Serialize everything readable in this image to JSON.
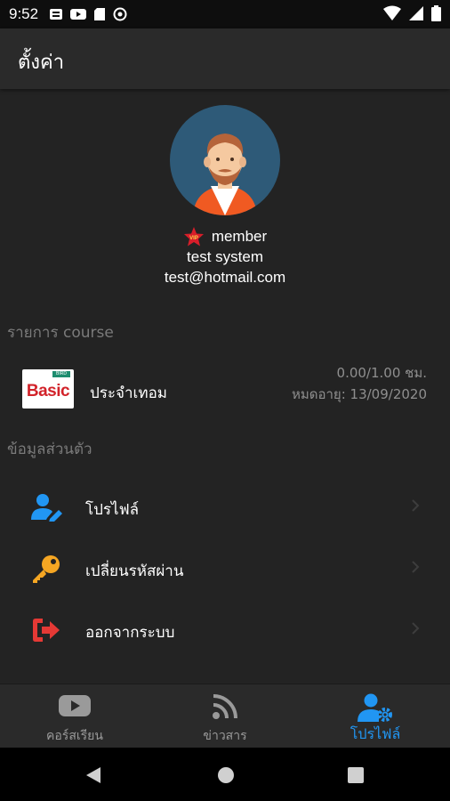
{
  "status_bar": {
    "time": "9:52",
    "left_icons": [
      "notification-icon",
      "youtube-icon",
      "sd-card-icon",
      "sync-icon"
    ],
    "right_icons": [
      "wifi-icon",
      "signal-icon",
      "battery-icon"
    ]
  },
  "app_bar": {
    "title": "ตั้งค่า"
  },
  "profile": {
    "badge_text": "VIP",
    "member_label": "member",
    "name": "test system",
    "email": "test@hotmail.com"
  },
  "course_section": {
    "title": "รายการ course",
    "course": {
      "logo_top": "BIRD",
      "logo_text": "Basic",
      "name": "ประจำเทอม",
      "hours": "0.00/1.00 ชม.",
      "expiry": "หมดอายุ: 13/09/2020"
    }
  },
  "personal_section": {
    "title": "ข้อมูลส่วนตัว",
    "items": [
      {
        "label": "โปรไฟล์",
        "icon": "user-edit-icon"
      },
      {
        "label": "เปลี่ยนรหัสผ่าน",
        "icon": "key-icon"
      },
      {
        "label": "ออกจากระบบ",
        "icon": "sign-out-icon"
      }
    ]
  },
  "bottom_nav": {
    "tabs": [
      {
        "label": "คอร์สเรียน",
        "icon": "youtube-play-icon"
      },
      {
        "label": "ข่าวสาร",
        "icon": "rss-icon"
      },
      {
        "label": "โปรไฟล์",
        "icon": "user-cog-icon",
        "active": true
      }
    ]
  },
  "colors": {
    "accent": "#2196f3",
    "background": "#232323",
    "app_bar": "#2a2a2a",
    "key_icon": "#f5a623",
    "sign_out_icon": "#e53935"
  }
}
